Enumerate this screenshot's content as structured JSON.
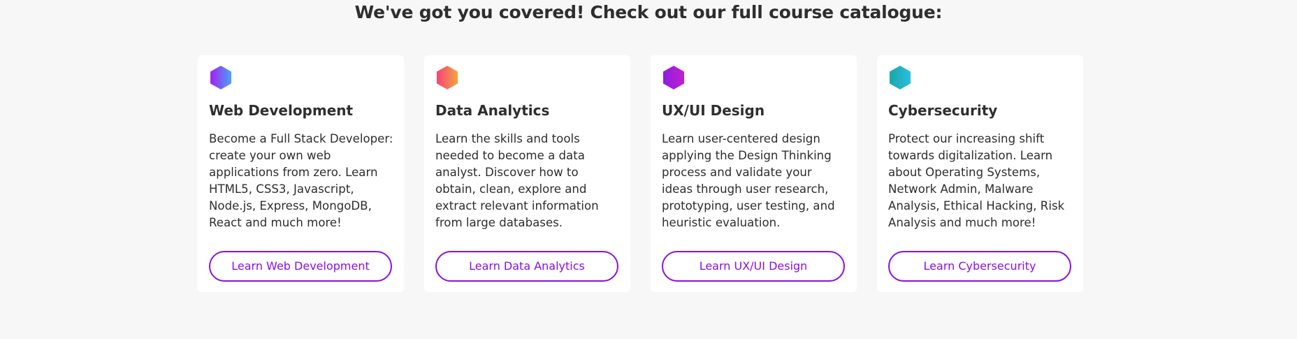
{
  "heading": "We've got you covered! Check out our full course catalogue:",
  "courses": [
    {
      "title": "Web Development",
      "description": "Become a Full Stack Developer: create your own web applications from zero. Learn HTML5, CSS3, Javascript, Node.js, Express, MongoDB, React and much more!",
      "button_label": "Learn Web Development",
      "icon": "hexagon-icon",
      "icon_gradient": [
        "#a41ff0",
        "#4aa3f7"
      ]
    },
    {
      "title": "Data Analytics",
      "description": "Learn the skills and tools needed to become a data analyst. Discover how to obtain, clean, explore and extract relevant information from large databases.",
      "button_label": "Learn Data Analytics",
      "icon": "hexagon-icon",
      "icon_gradient": [
        "#f5437a",
        "#f7a23d"
      ]
    },
    {
      "title": "UX/UI Design",
      "description": "Learn user-centered design applying the Design Thinking process and validate your ideas through user research, prototyping, user testing, and heuristic evaluation.",
      "button_label": "Learn UX/UI Design",
      "icon": "hexagon-icon",
      "icon_gradient": [
        "#8e1ee0",
        "#c21fcf"
      ]
    },
    {
      "title": "Cybersecurity",
      "description": "Protect our increasing shift towards digitalization. Learn about Operating Systems, Network Admin, Malware Analysis, Ethical Hacking, Risk Analysis and much more!",
      "button_label": "Learn Cybersecurity",
      "icon": "hexagon-icon",
      "icon_gradient": [
        "#1aa7a8",
        "#2bbde0"
      ]
    }
  ],
  "colors": {
    "accent": "#8a10e0",
    "background": "#f7f7f7",
    "card": "#ffffff",
    "text": "#2e2e2e"
  }
}
